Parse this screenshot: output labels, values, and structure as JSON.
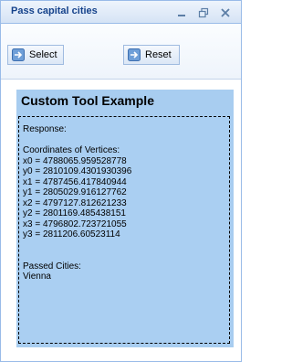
{
  "window": {
    "title": "Pass capital cities"
  },
  "toolbar": {
    "select_label": "Select",
    "reset_label": "Reset"
  },
  "panel": {
    "title": "Custom Tool Example",
    "response_label": "Response:",
    "coords_label": "Coordinates of Vertices:",
    "vertices": [
      "x0 = 4788065.959528778",
      "y0 = 2810109.4301930396",
      "x1 = 4787456.417840944",
      "y1 = 2805029.916127762",
      "x2 = 4797127.812621233",
      "y2 = 2801169.485438151",
      "x3 = 4796802.723721055",
      "y3 = 2811206.60523114"
    ],
    "passed_label": "Passed Cities:",
    "city": "Vienna"
  }
}
